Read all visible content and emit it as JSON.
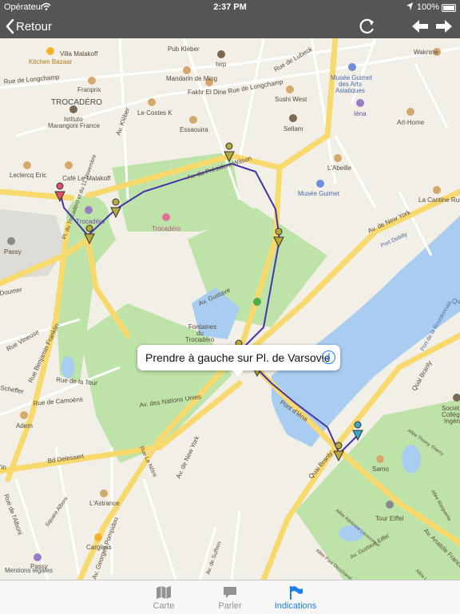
{
  "status_bar": {
    "carrier": "Opérateur",
    "time": "2:37 PM",
    "battery": "100%"
  },
  "nav_bar": {
    "back_label": "Retour"
  },
  "map": {
    "labels": {
      "villa_malakoff": "Villa Malakoff",
      "pub_kleber": "Pub Kleber",
      "isrp": "Isrp",
      "rue_de_lubeck": "Rue de Lubeck",
      "waknine": "Waknine",
      "kitchen_bazaar": "Kitchen Bazaar",
      "rue_de_longchamp_w": "Rue de Longchamp",
      "franprix": "Franprix",
      "mandarin_de_ming": "Mandarin de Ming",
      "fakhr_el_dine": "Fakhr El Dine",
      "rue_de_longchamp_e": "Rue de Longchamp",
      "musee_guimet_arts_1": "Musée Guimet",
      "musee_guimet_arts_2": "des Arts",
      "musee_guimet_arts_3": "Asiatiques",
      "trocadero_area": "TROCADÉRO",
      "sushi_west": "Sushi West",
      "istituto_1": "Istituto",
      "istituto_2": "Marangoni France",
      "le_costes_k": "Le Costes K",
      "av_kleber": "Av. Kléber",
      "iena": "Iéna",
      "art_home": "Art-Home",
      "essaouira": "Essaouira",
      "sellam": "Sellam",
      "av_du_president_wilson": "Av. du Président Wilson",
      "cafe_le_malakoff": "Café Le Malakoff",
      "leclercq_eric": "Leclercq Eric",
      "abeille": "L'Abeille",
      "pl_trocadero": "Pl. du Trocadéro et du 11 Novembre",
      "musee_guimet": "Musée Guimet",
      "la_cantine_russe": "La Cantine Russe",
      "trocadero_station": "Trocadéro",
      "trocadero_poi": "Trocadéro",
      "av_de_new_york_e": "Av. de New York",
      "passy_w": "Passy",
      "port_debilly": "Port Debilly",
      "doumer": "Doumer",
      "rue_vineuse": "Rue Vineuse",
      "rue_benjamin_franklin": "Rue Benjamin Franklin",
      "av_gustave": "Av. Gustave",
      "fontaines_1": "Fontaines",
      "fontaines_2": "du",
      "fontaines_3": "Trocadéro",
      "quai_r": "Qu",
      "port_de_la_bourdonnais": "Port de la Bourdonnais",
      "quai_branly_e": "Quai Branly",
      "rue_de_la_tour": "Rue de la Tour",
      "av_des_nations_unies": "Av. des Nations Unies",
      "pont_d_iena": "Pont d'Iéna",
      "scheffer": "Scheffer",
      "rue_de_camoens": "Rue de Camoëns",
      "adem": "Adem",
      "av_de_new_york_s": "Av. de New York",
      "quai_branly_s": "Quai Branly",
      "soci_1": "Sociét",
      "soci_2": "Collège",
      "soci_3": "Ingén",
      "allee_1": "Allée Thomy Thierry",
      "bd_delessert": "Bd Delessert",
      "samo": "Samo",
      "rue_le_notre": "Rue Le Nôtre",
      "in": "'in",
      "l_astrance": "L'Astrance",
      "tour_eiffel": "Tour Eiffel",
      "rue_de_l_alboni": "Rue de l'Alboni",
      "av_gustave_eiffel": "Av. Gustave Eiffel",
      "av_anatole_france": "Av. Anatole France",
      "allee_2": "Allée Adrienne Lecouvreur",
      "allee_3": "Allée Marguerite",
      "square_alboni": "Square Alboni",
      "carglass": "Carglass",
      "av_georges_pompidou": "Av. Georges Pompidou",
      "av_suffren": "Av. de Suffren",
      "passy_s": "Passy",
      "allee_4": "Allée Paul Deschanel",
      "allee_5": "Allée Léon Bourgeois"
    },
    "legal_text": "Mentions légales"
  },
  "callout": {
    "text": "Prendre à gauche sur Pl. de Varsovie"
  },
  "tab_bar": {
    "tabs": [
      {
        "label": "Carte",
        "active": false
      },
      {
        "label": "Parler",
        "active": false
      },
      {
        "label": "Indications",
        "active": true
      }
    ]
  },
  "colors": {
    "bar_dark": "#555555",
    "accent_blue": "#1c7cf4",
    "water": "#a8cdf0",
    "park": "#bde3a8",
    "major_road": "#f7d96e",
    "route_line": "#4433aa",
    "waypoint_olive": "#b5aa3a",
    "start_red": "#e0506a",
    "end_blue": "#39a7c8",
    "tab_inactive": "#929292"
  }
}
